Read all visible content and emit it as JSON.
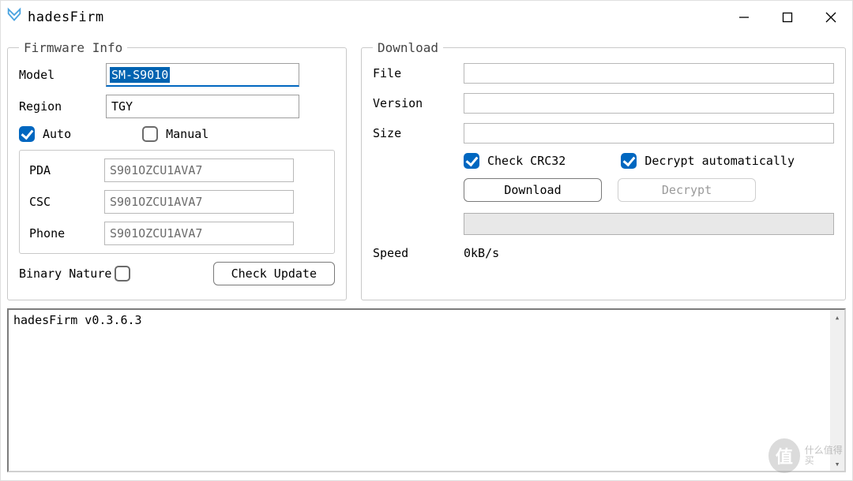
{
  "app": {
    "title": "hadesFirm"
  },
  "firmware": {
    "legend": "Firmware Info",
    "model_label": "Model",
    "model_value": "SM-S9010",
    "region_label": "Region",
    "region_value": "TGY",
    "auto_label": "Auto",
    "auto_checked": true,
    "manual_label": "Manual",
    "manual_checked": false,
    "pda_label": "PDA",
    "pda_value": "S901OZCU1AVA7",
    "csc_label": "CSC",
    "csc_value": "S901OZCU1AVA7",
    "phone_label": "Phone",
    "phone_value": "S901OZCU1AVA7",
    "binary_label": "Binary Nature",
    "binary_checked": false,
    "check_update_label": "Check Update"
  },
  "download": {
    "legend": "Download",
    "file_label": "File",
    "file_value": "",
    "version_label": "Version",
    "version_value": "",
    "size_label": "Size",
    "size_value": "",
    "crc_label": "Check CRC32",
    "crc_checked": true,
    "decrypt_auto_label": "Decrypt automatically",
    "decrypt_auto_checked": true,
    "download_btn": "Download",
    "decrypt_btn": "Decrypt",
    "speed_label": "Speed",
    "speed_value": "0kB/s"
  },
  "log": {
    "text": "hadesFirm v0.3.6.3"
  },
  "watermark": {
    "badge": "值",
    "text": "什么值得买"
  }
}
